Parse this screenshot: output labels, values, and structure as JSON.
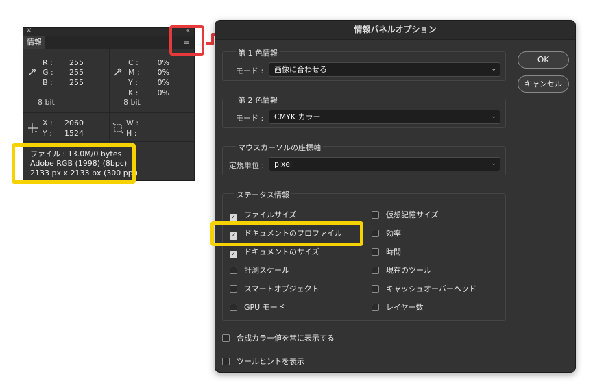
{
  "info_panel": {
    "close_glyph": "×",
    "collapse_glyph": "‹‹",
    "menu_glyph": "≡",
    "tab_label": "情報",
    "rgb": [
      {
        "label": "R :",
        "value": "255"
      },
      {
        "label": "G :",
        "value": "255"
      },
      {
        "label": "B :",
        "value": "255"
      }
    ],
    "cmyk": [
      {
        "label": "C :",
        "value": "0%"
      },
      {
        "label": "M :",
        "value": "0%"
      },
      {
        "label": "Y :",
        "value": "0%"
      },
      {
        "label": "K :",
        "value": "0%"
      }
    ],
    "rgb_bit": "8 bit",
    "cmyk_bit": "8 bit",
    "xy": [
      {
        "label": "X :",
        "value": "2060"
      },
      {
        "label": "Y :",
        "value": "1524"
      }
    ],
    "wh": [
      {
        "label": "W :",
        "value": ""
      },
      {
        "label": "H :",
        "value": ""
      }
    ],
    "doc_lines": [
      "ファイル : 13.0M/0 bytes",
      "Adobe RGB (1998) (8bpc)",
      "2133 px x 2133 px (300 ppi)"
    ]
  },
  "highlight_colors": {
    "yellow": "#f6d200",
    "red": "#e63a3a"
  },
  "dialog": {
    "title": "情報パネルオプション",
    "ok_label": "OK",
    "cancel_label": "キャンセル",
    "color1": {
      "title": "第 1 色情報",
      "mode_label": "モード :",
      "mode_value": "画像に合わせる"
    },
    "color2": {
      "title": "第 2 色情報",
      "mode_label": "モード :",
      "mode_value": "CMYK カラー"
    },
    "mouse": {
      "title": "マウスカーソルの座標軸",
      "unit_label": "定規単位 :",
      "unit_value": "pixel"
    },
    "status": {
      "title": "ステータス情報",
      "left": [
        {
          "label": "ファイルサイズ",
          "checked": true
        },
        {
          "label": "ドキュメントのプロファイル",
          "checked": true
        },
        {
          "label": "ドキュメントのサイズ",
          "checked": true
        },
        {
          "label": "計測スケール",
          "checked": false
        },
        {
          "label": "スマートオブジェクト",
          "checked": false
        },
        {
          "label": "GPU モード",
          "checked": false
        }
      ],
      "right": [
        {
          "label": "仮想記憶サイズ",
          "checked": false
        },
        {
          "label": "効率",
          "checked": false
        },
        {
          "label": "時間",
          "checked": false
        },
        {
          "label": "現在のツール",
          "checked": false
        },
        {
          "label": "キャッシュオーバーヘッド",
          "checked": false
        },
        {
          "label": "レイヤー数",
          "checked": false
        }
      ]
    },
    "always_show_composite": {
      "label": "合成カラー値を常に表示する",
      "checked": false
    },
    "show_tooltips": {
      "label": "ツールヒントを表示",
      "checked": false
    }
  }
}
